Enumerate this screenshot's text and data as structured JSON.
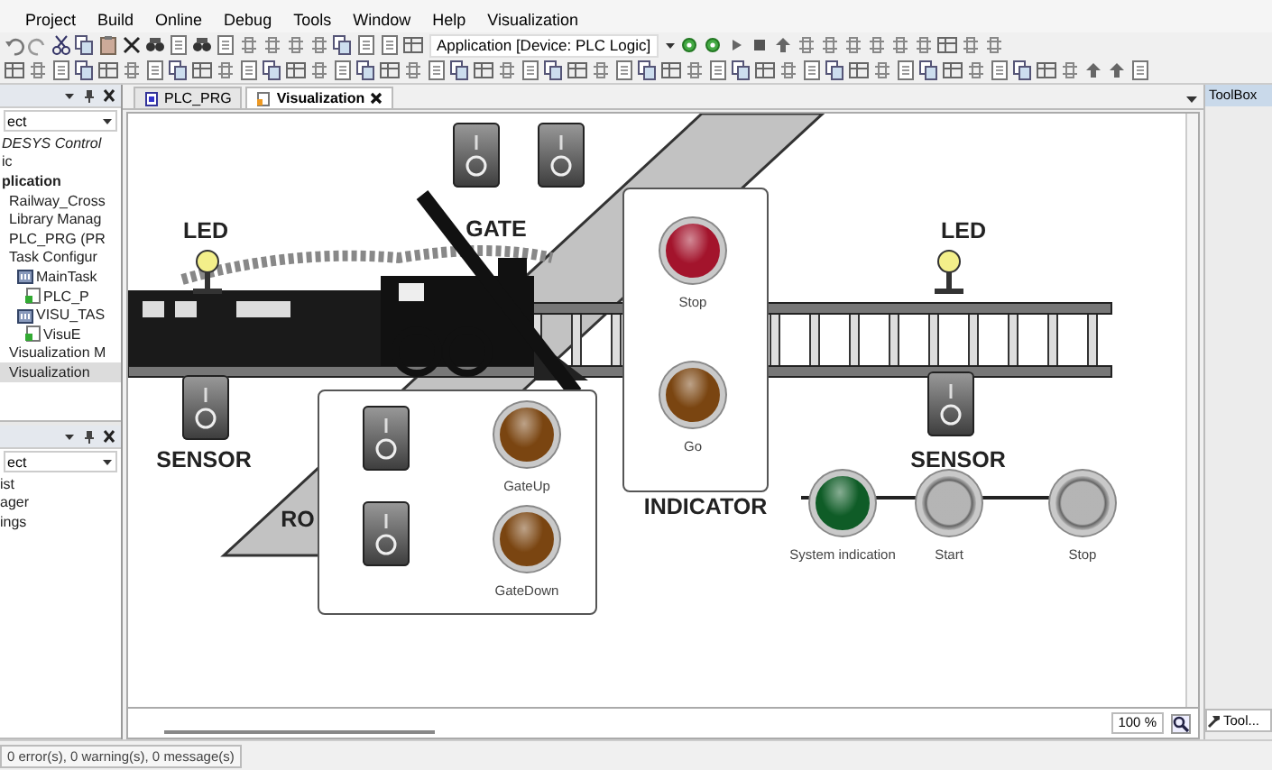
{
  "menu": [
    "Project",
    "Build",
    "Online",
    "Debug",
    "Tools",
    "Window",
    "Help",
    "Visualization"
  ],
  "toolbar": {
    "app_selector": "Application [Device: PLC Logic]"
  },
  "devices_panel": {
    "selector": "ect",
    "tree": [
      {
        "label": "DESYS Control",
        "kind": "device",
        "selected": false
      },
      {
        "label": "ic",
        "kind": "plc",
        "selected": false
      },
      {
        "label": "plication",
        "kind": "application",
        "selected": false,
        "children": [
          {
            "label": "Railway_Cross",
            "kind": "object",
            "selected": false
          },
          {
            "label": "Library Manag",
            "kind": "object",
            "selected": false
          },
          {
            "label": "PLC_PRG (PR",
            "kind": "object",
            "selected": false
          },
          {
            "label": "Task Configur",
            "kind": "object",
            "selected": false,
            "children": [
              {
                "label": "MainTask",
                "kind": "task",
                "selected": false,
                "children": [
                  {
                    "label": "PLC_P",
                    "kind": "pou",
                    "selected": false
                  }
                ]
              },
              {
                "label": "VISU_TAS",
                "kind": "task",
                "selected": false,
                "children": [
                  {
                    "label": "VisuE",
                    "kind": "pou",
                    "selected": false
                  }
                ]
              }
            ]
          },
          {
            "label": "Visualization M",
            "kind": "object",
            "selected": false
          },
          {
            "label": "Visualization",
            "kind": "object",
            "selected": true
          }
        ]
      }
    ]
  },
  "lower_panel": {
    "selector": "ect",
    "items": [
      "ist",
      "ager",
      "ings"
    ]
  },
  "tabs": [
    {
      "label": "PLC_PRG",
      "selected": false
    },
    {
      "label": "Visualization",
      "selected": true
    }
  ],
  "canvas": {
    "switches": [
      {
        "on": false
      },
      {
        "on": false
      },
      {
        "on": false
      },
      {
        "on": false
      },
      {
        "on": false
      },
      {
        "on": false
      }
    ],
    "labels": [
      "LED",
      "GATE",
      "LED",
      "SENSOR",
      "RO",
      "INDICATOR",
      "SENSOR"
    ],
    "lamps": [
      {
        "label": "GateUp",
        "kind": "lamp",
        "color": "#7a4511"
      },
      {
        "label": "GateDown",
        "kind": "lamp",
        "color": "#7a4511"
      },
      {
        "label": "Stop",
        "kind": "lamp",
        "color": "#a3142c"
      },
      {
        "label": "Go",
        "kind": "lamp",
        "color": "#7a4511"
      },
      {
        "label": "System indication",
        "kind": "lamp",
        "color": "#0f5c27"
      },
      {
        "label": "Start",
        "kind": "button",
        "color": "#9c9c9c"
      },
      {
        "label": "Stop",
        "kind": "button",
        "color": "#9c9c9c"
      }
    ]
  },
  "zoom": "100 %",
  "toolbox": {
    "title": "ToolBox",
    "tab": "Tool..."
  },
  "status_bar": "0 error(s), 0 warning(s), 0 message(s)"
}
